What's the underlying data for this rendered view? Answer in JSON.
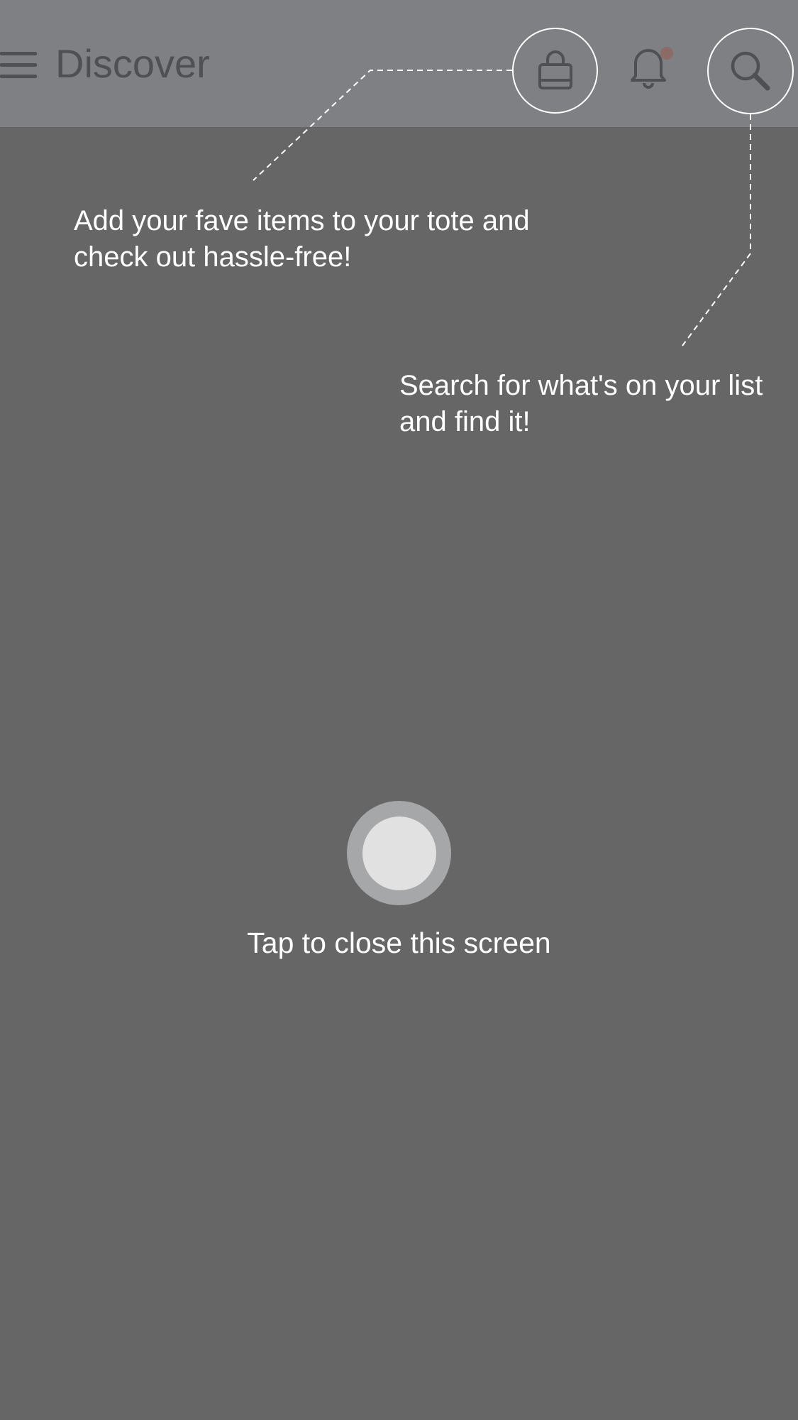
{
  "app_bar": {
    "title": "Discover",
    "menu_icon": "hamburger-menu-icon",
    "tote_icon": "shopping-bag-icon",
    "notification_icon": "bell-icon",
    "search_icon": "search-icon",
    "notification_badge_color": "#8c6a66"
  },
  "coach_marks": {
    "tote_tip": "Add your fave items to your tote and check out hassle-free!",
    "search_tip": "Search for what's on your list and find it!"
  },
  "close_prompt": {
    "label": "Tap to close this screen"
  },
  "colors": {
    "overlay": "#666666",
    "app_bar": "#7f8083",
    "icon": "#4f5053",
    "text": "#ffffff"
  }
}
